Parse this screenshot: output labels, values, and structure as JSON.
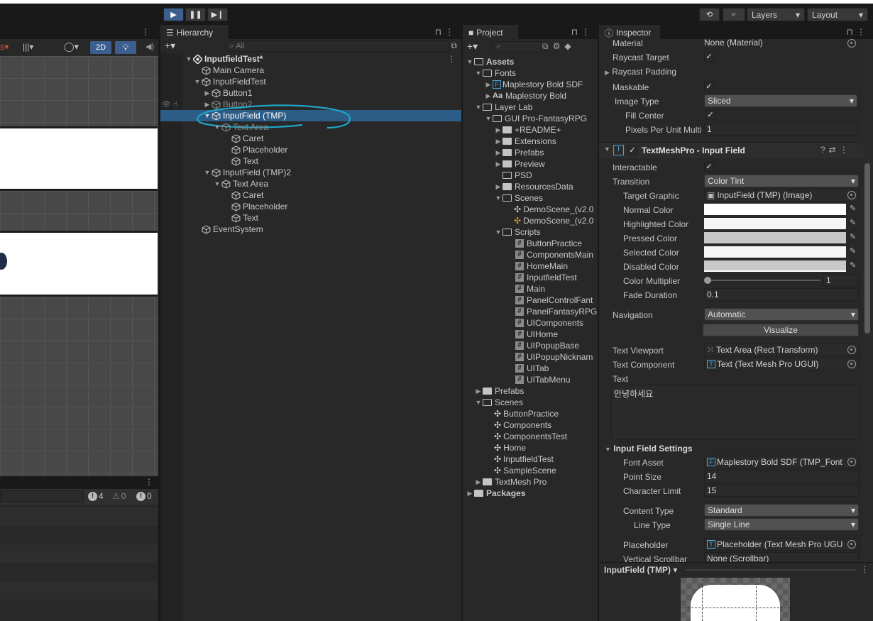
{
  "toolbar": {
    "play_icon": "play-icon",
    "pause_icon": "pause-icon",
    "step_icon": "step-icon",
    "layers_label": "Layers",
    "layout_label": "Layout"
  },
  "scene": {
    "mode_2d": "2D"
  },
  "console": {
    "error_count": "4",
    "warning_count": "0",
    "info_count": "0"
  },
  "hierarchy": {
    "tab_label": "Hierarchy",
    "search_placeholder": "All",
    "scene_name": "InputfieldTest*",
    "items": [
      {
        "label": "Main Camera"
      },
      {
        "label": "InputFieldTest"
      },
      {
        "label": "Button1"
      },
      {
        "label": "Button2"
      },
      {
        "label": "InputField (TMP)"
      },
      {
        "label": "Text Area"
      },
      {
        "label": "Caret"
      },
      {
        "label": "Placeholder"
      },
      {
        "label": "Text"
      },
      {
        "label": "InputField (TMP)2"
      },
      {
        "label": "Text Area"
      },
      {
        "label": "Caret"
      },
      {
        "label": "Placeholder"
      },
      {
        "label": "Text"
      },
      {
        "label": "EventSystem"
      }
    ]
  },
  "project": {
    "tab_label": "Project",
    "items": [
      {
        "label": "Assets"
      },
      {
        "label": "Fonts"
      },
      {
        "label": "Maplestory Bold SDF"
      },
      {
        "label": "Maplestory Bold"
      },
      {
        "label": "Layer Lab"
      },
      {
        "label": "GUI Pro-FantasyRPG"
      },
      {
        "label": "+README+"
      },
      {
        "label": "Extensions"
      },
      {
        "label": "Prefabs"
      },
      {
        "label": "Preview"
      },
      {
        "label": "PSD"
      },
      {
        "label": "ResourcesData"
      },
      {
        "label": "Scenes"
      },
      {
        "label": "DemoScene_(v2.0"
      },
      {
        "label": "DemoScene_(v2.0"
      },
      {
        "label": "Scripts"
      },
      {
        "label": "ButtonPractice"
      },
      {
        "label": "ComponentsMain"
      },
      {
        "label": "HomeMain"
      },
      {
        "label": "InputfieldTest"
      },
      {
        "label": "Main"
      },
      {
        "label": "PanelControlFant"
      },
      {
        "label": "PanelFantasyRPG"
      },
      {
        "label": "UIComponents"
      },
      {
        "label": "UIHome"
      },
      {
        "label": "UIPopupBase"
      },
      {
        "label": "UIPopupNicknam"
      },
      {
        "label": "UITab"
      },
      {
        "label": "UITabMenu"
      },
      {
        "label": "Prefabs"
      },
      {
        "label": "Scenes"
      },
      {
        "label": "ButtonPractice"
      },
      {
        "label": "Components"
      },
      {
        "label": "ComponentsTest"
      },
      {
        "label": "Home"
      },
      {
        "label": "InputfieldTest"
      },
      {
        "label": "SampleScene"
      },
      {
        "label": "TextMesh Pro"
      },
      {
        "label": "Packages"
      }
    ]
  },
  "inspector": {
    "tab_label": "Inspector",
    "image": {
      "material_label": "Material",
      "material_value": "None (Material)",
      "raycast_target_label": "Raycast Target",
      "raycast_padding_label": "Raycast Padding",
      "maskable_label": "Maskable",
      "image_type_label": "Image Type",
      "image_type_value": "Sliced",
      "fill_center_label": "Fill Center",
      "ppu_label": "Pixels Per Unit Multi",
      "ppu_value": "1"
    },
    "tmp_input": {
      "title": "TextMeshPro - Input Field",
      "interactable_label": "Interactable",
      "transition_label": "Transition",
      "transition_value": "Color Tint",
      "target_graphic_label": "Target Graphic",
      "target_graphic_value": "InputField (TMP) (Image)",
      "normal_color_label": "Normal Color",
      "highlighted_color_label": "Highlighted Color",
      "pressed_color_label": "Pressed Color",
      "selected_color_label": "Selected Color",
      "disabled_color_label": "Disabled Color",
      "color_multiplier_label": "Color Multiplier",
      "color_multiplier_value": "1",
      "fade_duration_label": "Fade Duration",
      "fade_duration_value": "0.1",
      "navigation_label": "Navigation",
      "navigation_value": "Automatic",
      "visualize_label": "Visualize",
      "text_viewport_label": "Text Viewport",
      "text_viewport_value": "Text Area (Rect Transform)",
      "text_component_label": "Text Component",
      "text_component_value": "Text (Text Mesh Pro UGUI)",
      "text_label": "Text",
      "text_value": "안녕하세요"
    },
    "settings": {
      "title": "Input Field Settings",
      "font_asset_label": "Font Asset",
      "font_asset_value": "Maplestory Bold SDF (TMP_Font",
      "point_size_label": "Point Size",
      "point_size_value": "14",
      "char_limit_label": "Character Limit",
      "char_limit_value": "15",
      "content_type_label": "Content Type",
      "content_type_value": "Standard",
      "line_type_label": "Line Type",
      "line_type_value": "Single Line",
      "placeholder_label": "Placeholder",
      "placeholder_value": "Placeholder (Text Mesh Pro UGU",
      "vscroll_label": "Vertical Scrollbar",
      "vscroll_value": "None (Scrollbar)"
    },
    "preview_title": "InputField (TMP)"
  }
}
